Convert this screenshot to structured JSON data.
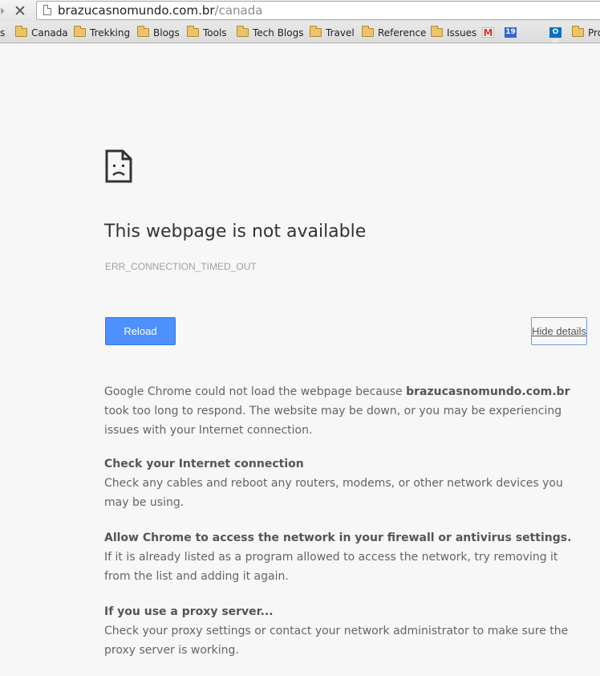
{
  "browser": {
    "url_host": "brazucasnomundo.com.br",
    "url_path": "/canada",
    "stop_glyph": "✕",
    "forward_glyph": "⏵"
  },
  "bookmarks": {
    "partial_first": "s",
    "folders": [
      "Canada",
      "Trekking",
      "Blogs",
      "Tools",
      "Tech Blogs",
      "Travel",
      "Reference",
      "Issues"
    ],
    "app_icons": [
      {
        "name": "gmail-icon",
        "glyph": "M"
      },
      {
        "name": "calendar-icon",
        "glyph": "19"
      },
      {
        "name": "apple-icon",
        "glyph": ""
      },
      {
        "name": "outlook-icon",
        "glyph": "O✉"
      }
    ],
    "partial_last": "Pro"
  },
  "error_page": {
    "icon": "sad-page-icon",
    "title": "This webpage is not available",
    "code": "ERR_CONNECTION_TIMED_OUT",
    "reload_label": "Reload",
    "details_label": "Hide details",
    "accent_color": "#4d90fe",
    "summary_before": "Google Chrome could not load the webpage because ",
    "summary_host": "brazucasnomundo.com.br",
    "summary_after": " took too long to respond. The website may be down, or you may be experiencing issues with your Internet connection.",
    "sections": [
      {
        "heading": "Check your Internet connection",
        "body": "Check any cables and reboot any routers, modems, or other network devices you may be using."
      },
      {
        "heading": "Allow Chrome to access the network in your firewall or antivirus settings.",
        "body": "If it is already listed as a program allowed to access the network, try removing it from the list and adding it again."
      },
      {
        "heading": "If you use a proxy server...",
        "body": "Check your proxy settings or contact your network administrator to make sure the proxy server is working."
      }
    ]
  }
}
